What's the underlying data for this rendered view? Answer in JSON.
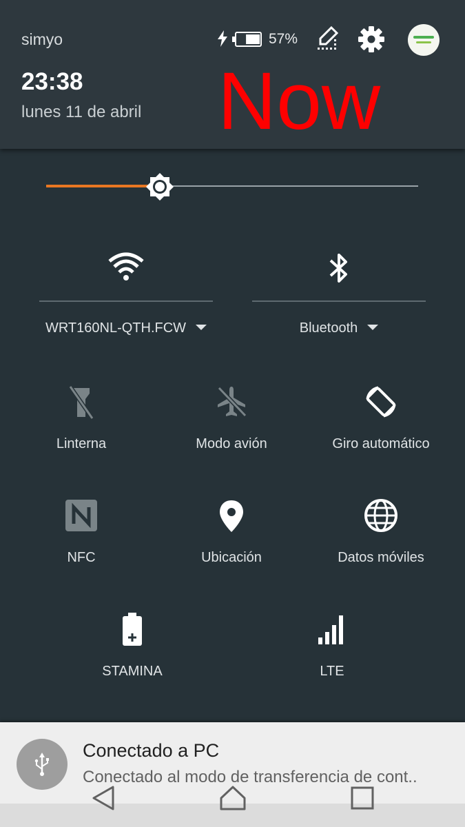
{
  "status_bar": {
    "carrier": "simyo",
    "battery_percent": "57%",
    "battery_level": 0.57,
    "charging": true
  },
  "header": {
    "time": "23:38",
    "date": "lunes 11 de abril",
    "overlay_label": "Now",
    "overlay_color": "#ff0000"
  },
  "brightness": {
    "level": 0.305,
    "accent_color": "#e87722"
  },
  "toggles_top": [
    {
      "name": "wifi",
      "icon": "wifi-icon",
      "label": "WRT160NL-QTH.FCW",
      "active": true
    },
    {
      "name": "bluetooth",
      "icon": "bluetooth-icon",
      "label": "Bluetooth",
      "active": true
    }
  ],
  "tiles": [
    {
      "name": "linterna",
      "icon": "flashlight-off-icon",
      "label": "Linterna",
      "active": false
    },
    {
      "name": "modo-avion",
      "icon": "airplane-off-icon",
      "label": "Modo avión",
      "active": false
    },
    {
      "name": "giro",
      "icon": "auto-rotate-icon",
      "label": "Giro automático",
      "active": true
    },
    {
      "name": "nfc",
      "icon": "nfc-icon",
      "label": "NFC",
      "active": false
    },
    {
      "name": "ubicacion",
      "icon": "location-icon",
      "label": "Ubicación",
      "active": true
    },
    {
      "name": "datos",
      "icon": "globe-icon",
      "label": "Datos móviles",
      "active": true
    },
    {
      "name": "stamina",
      "icon": "stamina-battery-icon",
      "label": "STAMINA",
      "active": true
    },
    {
      "name": "lte",
      "icon": "signal-bars-icon",
      "label": "LTE",
      "active": true
    }
  ],
  "notification": {
    "icon": "usb-icon",
    "title": "Conectado a PC",
    "text": "Conectado al modo de transferencia de cont.."
  },
  "navbar": {
    "back": "back-icon",
    "home": "home-icon",
    "recents": "recents-icon"
  }
}
